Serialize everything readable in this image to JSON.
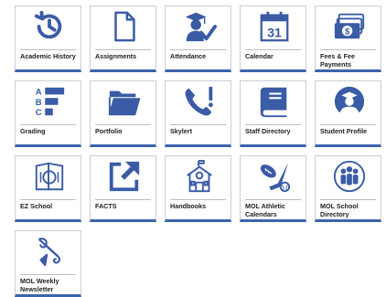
{
  "accent_color": "#3d63ad",
  "icon_color": "#3a5ba5",
  "tiles": [
    {
      "label": "Academic History",
      "icon": "history-clock-icon"
    },
    {
      "label": "Assignments",
      "icon": "document-icon"
    },
    {
      "label": "Attendance",
      "icon": "graduate-check-icon"
    },
    {
      "label": "Calendar",
      "icon": "calendar-icon",
      "calendar_day": "31"
    },
    {
      "label": "Fees & Fee Payments",
      "icon": "money-icon"
    },
    {
      "label": "Grading",
      "icon": "grade-list-icon",
      "grade_letters": [
        "A",
        "B",
        "C"
      ]
    },
    {
      "label": "Portfolio",
      "icon": "folder-icon"
    },
    {
      "label": "Skylert",
      "icon": "phone-alert-icon"
    },
    {
      "label": "Staff Directory",
      "icon": "book-icon"
    },
    {
      "label": "Student Profile",
      "icon": "student-avatar-icon"
    },
    {
      "label": "EZ School",
      "icon": "menu-plate-icon"
    },
    {
      "label": "FACTS",
      "icon": "external-link-icon"
    },
    {
      "label": "Handbooks",
      "icon": "school-building-icon"
    },
    {
      "label": "MOL Athletic Calendars",
      "icon": "sports-icon"
    },
    {
      "label": "MOL School Directory",
      "icon": "people-group-icon"
    },
    {
      "label": "MOL Weekly Newsletter",
      "icon": "scroll-icon"
    }
  ]
}
